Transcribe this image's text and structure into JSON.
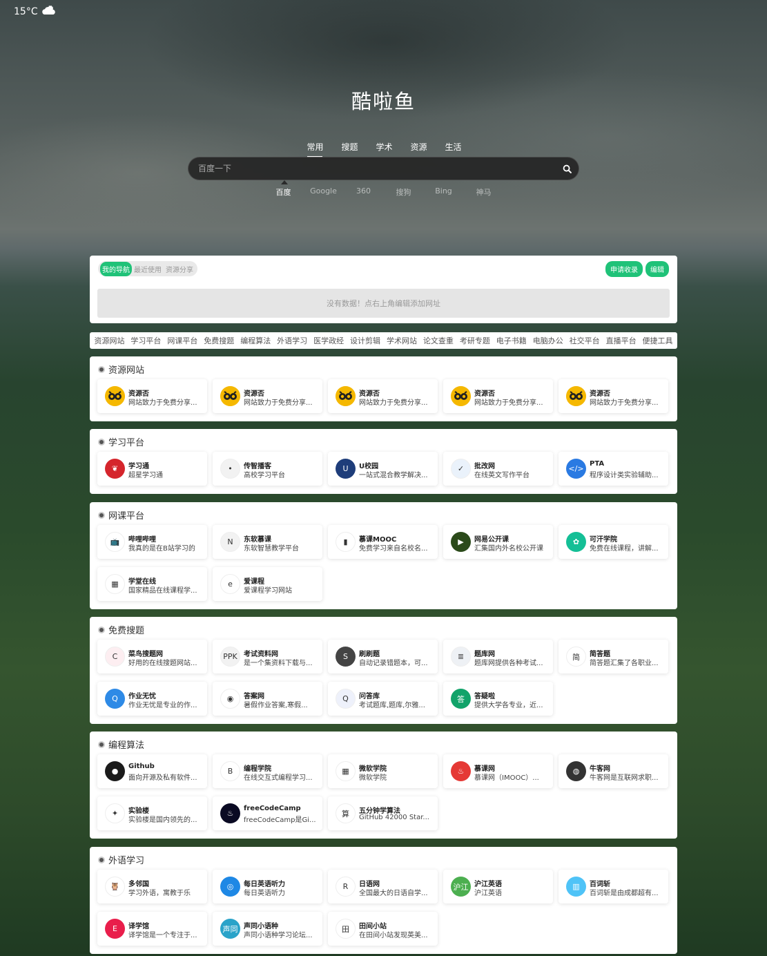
{
  "weather": {
    "temp": "15°C"
  },
  "site": {
    "title": "酷啦鱼"
  },
  "search": {
    "categories": [
      "常用",
      "搜题",
      "学术",
      "资源",
      "生活"
    ],
    "active_category": 0,
    "placeholder": "百度一下",
    "engines": [
      "百度",
      "Google",
      "360",
      "搜狗",
      "Bing",
      "神马"
    ],
    "active_engine": 0
  },
  "panel": {
    "tabs": [
      "我的导航",
      "最近使用",
      "资源分享"
    ],
    "buttons": [
      "申请收录",
      "编辑"
    ],
    "empty_text": "没有数据！点右上角编辑添加网址"
  },
  "nav": [
    "资源网站",
    "学习平台",
    "网课平台",
    "免费搜题",
    "编程算法",
    "外语学习",
    "医学政经",
    "设计剪辑",
    "学术网站",
    "论文查重",
    "考研专题",
    "电子书籍",
    "电脑办公",
    "社交平台",
    "直播平台",
    "便捷工具"
  ],
  "sections": [
    {
      "title": "资源网站",
      "items": [
        {
          "name": "资源否",
          "desc": "网站致力于免费分享...",
          "icon": "resource-icon",
          "color": "#f5b800"
        },
        {
          "name": "资源否",
          "desc": "网站致力于免费分享...",
          "icon": "resource-icon",
          "color": "#f5b800"
        },
        {
          "name": "资源否",
          "desc": "网站致力于免费分享...",
          "icon": "resource-icon",
          "color": "#f5b800"
        },
        {
          "name": "资源否",
          "desc": "网站致力于免费分享...",
          "icon": "resource-icon",
          "color": "#f5b800"
        },
        {
          "name": "资源否",
          "desc": "网站致力于免费分享...",
          "icon": "resource-icon",
          "color": "#f5b800"
        }
      ]
    },
    {
      "title": "学习平台",
      "items": [
        {
          "name": "学习通",
          "desc": "超星学习通",
          "icon": "xuexitong-icon",
          "color": "#d5252c",
          "glyph": "❦"
        },
        {
          "name": "传智播客",
          "desc": "高校学习平台",
          "icon": "chuanzhi-icon",
          "color": "#f2f2f2",
          "glyph": "•"
        },
        {
          "name": "U校园",
          "desc": "一站式混合教学解决...",
          "icon": "uxiaoyuan-icon",
          "color": "#1e3d7a",
          "glyph": "U"
        },
        {
          "name": "批改网",
          "desc": "在线英文写作平台",
          "icon": "pigai-icon",
          "color": "#eaf2fb",
          "glyph": "✓"
        },
        {
          "name": "PTA",
          "desc": "程序设计类实验辅助...",
          "icon": "pta-icon",
          "color": "#2a7ae2",
          "glyph": "&lt;/&gt;"
        }
      ]
    },
    {
      "title": "网课平台",
      "items": [
        {
          "name": "哔哩哔哩",
          "desc": "我真的是在B站学习的",
          "icon": "bilibili-icon",
          "color": "#ffffff",
          "glyph": "📺"
        },
        {
          "name": "东软慕课",
          "desc": "东软智慧教学平台",
          "icon": "neusoft-icon",
          "color": "#f2f2f2",
          "glyph": "N"
        },
        {
          "name": "慕课MOOC",
          "desc": "免费学习来自名校名...",
          "icon": "mooc-icon",
          "color": "#ffffff",
          "glyph": "▮"
        },
        {
          "name": "网易公开课",
          "desc": "汇集国内外名校公开课",
          "icon": "netease-open-icon",
          "color": "#2b4a1a",
          "glyph": "▶"
        },
        {
          "name": "可汗学院",
          "desc": "免费在线课程，讲解...",
          "icon": "khan-icon",
          "color": "#14bf96",
          "glyph": "✿"
        },
        {
          "name": "学堂在线",
          "desc": "国家精品在线课程学...",
          "icon": "xuetang-icon",
          "color": "#ffffff",
          "glyph": "▦"
        },
        {
          "name": "爱课程",
          "desc": "爱课程学习网站",
          "icon": "icourse-icon",
          "color": "#ffffff",
          "glyph": "e"
        }
      ]
    },
    {
      "title": "免费搜题",
      "items": [
        {
          "name": "菜鸟搜题网",
          "desc": "好用的在线搜题网站...",
          "icon": "cainiao-icon",
          "color": "#fdeef1",
          "glyph": "C"
        },
        {
          "name": "考试资料网",
          "desc": "是一个集资料下载与...",
          "icon": "ppkao-icon",
          "color": "#f2f2f2",
          "glyph": "PPK"
        },
        {
          "name": "刷刷题",
          "desc": "自动记录错题本，可...",
          "icon": "shuashua-icon",
          "color": "#444444",
          "glyph": "S"
        },
        {
          "name": "题库网",
          "desc": "题库网提供各种考试...",
          "icon": "tiku-icon",
          "color": "#eef1f5",
          "glyph": "≣"
        },
        {
          "name": "简答题",
          "desc": "简答题汇集了各职业...",
          "icon": "jianda-icon",
          "color": "#ffffff",
          "glyph": "简"
        },
        {
          "name": "作业无忧",
          "desc": "作业无忧是专业的作...",
          "icon": "zuoye-icon",
          "color": "#2e8ae6",
          "glyph": "Q"
        },
        {
          "name": "答案网",
          "desc": "暑假作业答案,寒假...",
          "icon": "daan-icon",
          "color": "#ffffff",
          "glyph": "◉"
        },
        {
          "name": "问答库",
          "desc": "考试题库,题库,尔雅...",
          "icon": "wenda-icon",
          "color": "#eef1fb",
          "glyph": "Q"
        },
        {
          "name": "答疑啦",
          "desc": "提供大学各专业，近...",
          "icon": "dayi-icon",
          "color": "#12a36a",
          "glyph": "答"
        }
      ]
    },
    {
      "title": "编程算法",
      "items": [
        {
          "name": "Github",
          "desc": "面向开源及私有软件...",
          "icon": "github-icon",
          "color": "#1b1b1b",
          "glyph": "●"
        },
        {
          "name": "编程学院",
          "desc": "在线交互式编程学习...",
          "icon": "biancheng-icon",
          "color": "#ffffff",
          "glyph": "B"
        },
        {
          "name": "微软学院",
          "desc": "微软学院",
          "icon": "microsoft-icon",
          "color": "#ffffff",
          "glyph": "▦"
        },
        {
          "name": "慕课网",
          "desc": "慕课网（IMOOC）...",
          "icon": "imooc-icon",
          "color": "#e53935",
          "glyph": "♨"
        },
        {
          "name": "牛客网",
          "desc": "牛客网是互联网求职...",
          "icon": "nowcoder-icon",
          "color": "#333333",
          "glyph": "◍"
        },
        {
          "name": "实验楼",
          "desc": "实验楼是国内领先的...",
          "icon": "shiyanlou-icon",
          "color": "#ffffff",
          "glyph": "✦"
        },
        {
          "name": "freeCodeCamp",
          "desc": "freeCodeCamp是Gi...",
          "icon": "freecodecamp-icon",
          "color": "#0a0a23",
          "glyph": "♨"
        },
        {
          "name": "五分钟学算法",
          "desc": "GitHub 42000 Star...",
          "icon": "algo-icon",
          "color": "#ffffff",
          "glyph": "算"
        }
      ]
    },
    {
      "title": "外语学习",
      "items": [
        {
          "name": "多邻国",
          "desc": "学习外语，寓教于乐",
          "icon": "duolingo-icon",
          "color": "#ffffff",
          "glyph": "🦉"
        },
        {
          "name": "每日英语听力",
          "desc": "每日英语听力",
          "icon": "eudic-icon",
          "color": "#1e88e5",
          "glyph": "◎"
        },
        {
          "name": "日语网",
          "desc": "全国最大的日语自学...",
          "icon": "riyu-icon",
          "color": "#ffffff",
          "glyph": "R"
        },
        {
          "name": "沪江英语",
          "desc": "沪江英语",
          "icon": "hujiang-icon",
          "color": "#4caf50",
          "glyph": "沪江"
        },
        {
          "name": "百词斩",
          "desc": "百词斩是由成都超有...",
          "icon": "baicizhan-icon",
          "color": "#4fc3f7",
          "glyph": "▥"
        },
        {
          "name": "译学馆",
          "desc": "译学馆是一个专注于...",
          "icon": "yixueguan-icon",
          "color": "#e91e4b",
          "glyph": "E"
        },
        {
          "name": "声同小语种",
          "desc": "声同小语种学习论坛...",
          "icon": "shengtong-icon",
          "color": "#2aa3c9",
          "glyph": "声同"
        },
        {
          "name": "田间小站",
          "desc": "在田间小站发现英美...",
          "icon": "tianjian-icon",
          "color": "#ffffff",
          "glyph": "田"
        }
      ]
    }
  ]
}
